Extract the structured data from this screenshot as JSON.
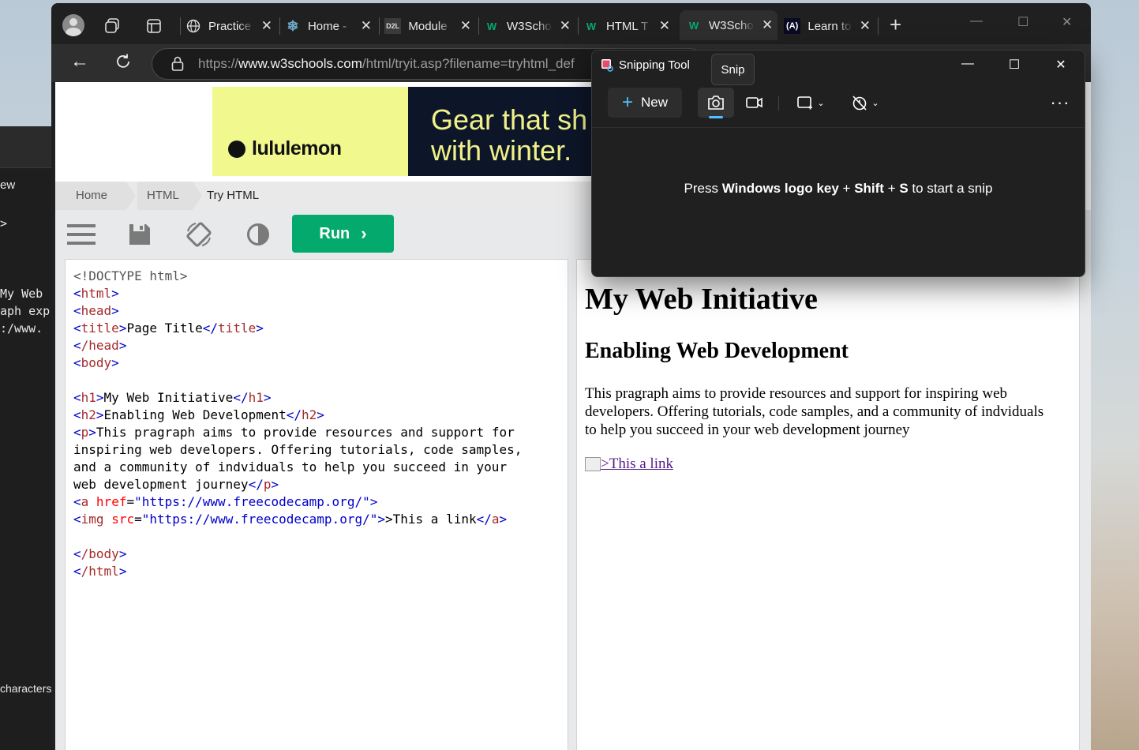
{
  "background_terminal": {
    "line1": "ew",
    "line2": ">",
    "line3": " My Web",
    "line4": "aph exp",
    "line5": ":/www.",
    "line6": "characters"
  },
  "browser": {
    "tabs": [
      {
        "title": "Practice",
        "favicon": "globe-icon"
      },
      {
        "title": "Home -",
        "favicon": "snowflake-icon"
      },
      {
        "title": "Module",
        "favicon": "D2L"
      },
      {
        "title": "W3Scho",
        "favicon": "w3schools-icon"
      },
      {
        "title": "HTML T",
        "favicon": "w3schools-icon"
      },
      {
        "title": "W3Scho",
        "favicon": "w3schools-icon"
      },
      {
        "title": "Learn to",
        "favicon": "(A)"
      }
    ],
    "url_prefix": "https://",
    "url_domain": "www.w3schools.com",
    "url_path": "/html/tryit.asp?filename=tryhtml_def"
  },
  "ad": {
    "brand": "lululemon",
    "headline_line1": "Gear that sh",
    "headline_line2": "with winter."
  },
  "breadcrumb": {
    "home": "Home",
    "html": "HTML",
    "current": "Try HTML"
  },
  "toolbar": {
    "run_label": "Run"
  },
  "editor": {
    "l1": "<!DOCTYPE html>",
    "html_open": "html",
    "head_open": "head",
    "title_tag": "title",
    "title_text": "Page Title",
    "head_close": "/head",
    "body_open": "body",
    "h1_tag": "h1",
    "h1_text": "My Web Initiative",
    "h2_tag": "h2",
    "h2_text": "Enabling Web Development",
    "p_tag": "p",
    "p_line1": "This pragraph aims to provide resources and support for",
    "p_line2": "inspiring web developers. Offering tutorials, code samples,",
    "p_line3": "and a community of indviduals to help you succeed in your",
    "p_line4": "web development journey",
    "a_tag": "a",
    "href_attr": "href",
    "href_value": "\"https://www.freecodecamp.org/\"",
    "img_tag": "img",
    "src_attr": "src",
    "src_value": "\"https://www.freecodecamp.org/\"",
    "a_text": ">This a link",
    "body_close": "/body",
    "html_close": "/html"
  },
  "preview": {
    "h1": "My Web Initiative",
    "h2": "Enabling Web Development",
    "paragraph_l1": "This pragraph aims to provide resources and support for inspiring web",
    "paragraph_l2": "developers. Offering tutorials, code samples, and a community of indviduals",
    "paragraph_l3": "to help you succeed in your web development journey",
    "link_text": ">This a link"
  },
  "snipping_tool": {
    "title": "Snipping Tool",
    "new_label": "New",
    "tooltip": "Snip",
    "msg_prefix": "Press ",
    "msg_key1": "Windows logo key",
    "msg_plus1": " + ",
    "msg_key2": "Shift",
    "msg_plus2": " + ",
    "msg_key3": "S",
    "msg_suffix": " to start a snip"
  },
  "colors": {
    "run_button": "#04aa6d",
    "ad_yellow": "#f0f88e",
    "ad_navy": "#0d1629",
    "snip_accent": "#4cc2ff"
  }
}
